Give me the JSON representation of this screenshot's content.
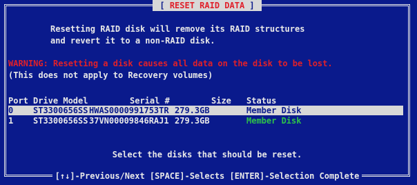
{
  "dialog": {
    "title_prefix": "[ ",
    "title": "RESET RAID DATA",
    "title_suffix": " ]",
    "intro_line1": "Resetting RAID disk will remove its RAID structures",
    "intro_line2": "and revert it to a non-RAID disk.",
    "warning": "WARNING: Resetting a disk causes all data on the disk to be lost.",
    "note": "(This does not apply to Recovery volumes)",
    "prompt": "Select the disks that should be reset.",
    "help": "[↑↓]-Previous/Next  [SPACE]-Selects [ENTER]-Selection Complete"
  },
  "table": {
    "columns": [
      "Port",
      "Drive Model",
      "Serial #",
      "Size",
      "Status"
    ],
    "rows": [
      {
        "port": "0",
        "model": "ST3300656SS",
        "serial": "HWAS0000991753TR",
        "size": "279.3GB",
        "status": "Member Disk",
        "selected": true
      },
      {
        "port": "1",
        "model": "ST3300656SS",
        "serial": "37VN00009846RAJ1",
        "size": "279.3GB",
        "status": "Member Disk",
        "selected": false
      }
    ]
  },
  "colors": {
    "background": "#0a1a8c",
    "text": "#e8e8e8",
    "warning": "#e0202a",
    "status_green": "#2ec24a",
    "highlight": "#d8d8d8"
  }
}
